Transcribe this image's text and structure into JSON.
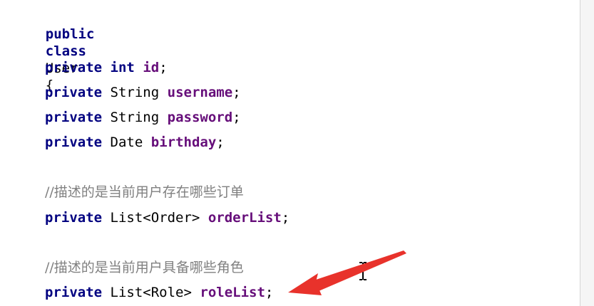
{
  "editor": {
    "lines": {
      "class_decl": {
        "kw_public": "public",
        "kw_class": "class",
        "class_name": "User",
        "brace": "{"
      },
      "field_id": {
        "kw": "private",
        "type": "int",
        "name": "id",
        "semi": ";"
      },
      "field_username": {
        "kw": "private",
        "type": "String",
        "name": "username",
        "semi": ";"
      },
      "field_password": {
        "kw": "private",
        "type": "String",
        "name": "password",
        "semi": ";"
      },
      "field_birthday": {
        "kw": "private",
        "type": "Date",
        "name": "birthday",
        "semi": ";"
      },
      "comment_orders": "//描述的是当前用户存在哪些订单",
      "field_orderlist": {
        "kw": "private",
        "type": "List<Order>",
        "name": "orderList",
        "semi": ";"
      },
      "comment_roles": "//描述的是当前用户具备哪些角色",
      "field_rolelist": {
        "kw": "private",
        "type": "List<Role>",
        "name": "roleList",
        "semi": ";"
      }
    }
  },
  "colors": {
    "keyword": "#000080",
    "field": "#660e7a",
    "comment": "#808080",
    "annotation_arrow": "#e8322b"
  },
  "icons": {
    "cursor": "text-cursor-icon",
    "annotation": "red-arrow-icon"
  }
}
